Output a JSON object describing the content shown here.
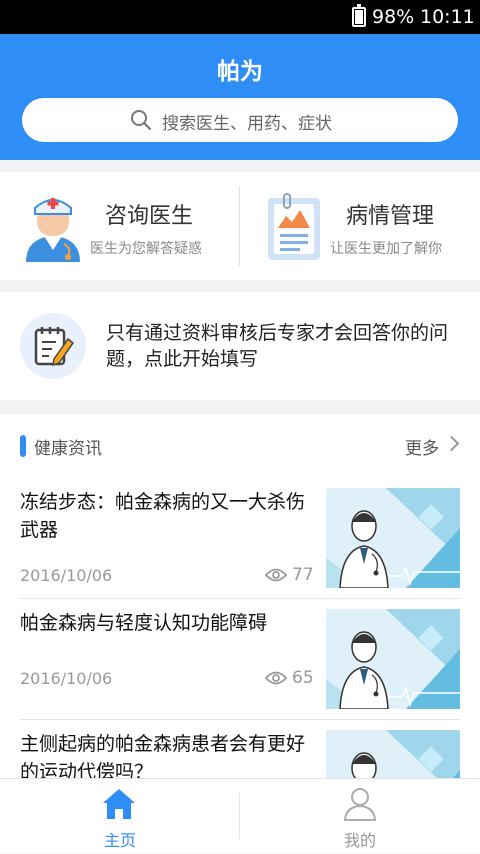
{
  "status": {
    "battery": "98%",
    "time": "10:11"
  },
  "header": {
    "title": "帕为",
    "search_placeholder": "搜索医生、用药、症状"
  },
  "cards": [
    {
      "title": "咨询医生",
      "subtitle": "医生为您解答疑惑"
    },
    {
      "title": "病情管理",
      "subtitle": "让医生更加了解你"
    }
  ],
  "notice": {
    "text": "只有通过资料审核后专家才会回答你的问题，点此开始填写"
  },
  "news": {
    "title": "健康资讯",
    "more_label": "更多",
    "items": [
      {
        "title": "冻结步态：帕金森病的又一大杀伤武器",
        "date": "2016/10/06",
        "views": "77"
      },
      {
        "title": "帕金森病与轻度认知功能障碍",
        "date": "2016/10/06",
        "views": "65"
      },
      {
        "title": "主侧起病的帕金森病患者会有更好的运动代偿吗？",
        "date": "",
        "views": ""
      }
    ]
  },
  "tabs": [
    {
      "label": "主页",
      "active": true
    },
    {
      "label": "我的",
      "active": false
    }
  ],
  "colors": {
    "primary": "#2f8ef6",
    "muted": "#999999"
  }
}
